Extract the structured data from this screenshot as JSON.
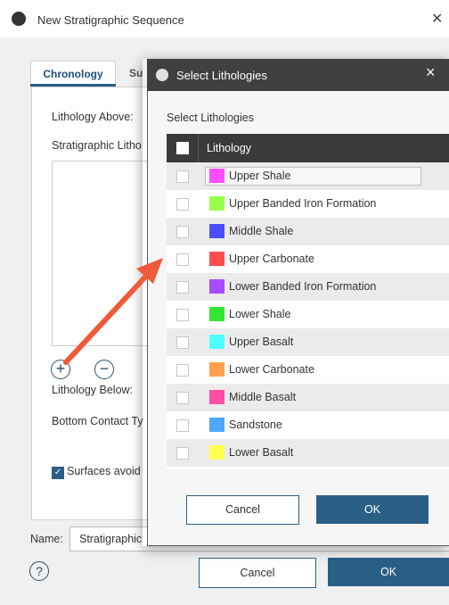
{
  "outer_dialog": {
    "title": "New Stratigraphic Sequence",
    "tabs": [
      {
        "label": "Chronology"
      },
      {
        "label": "Su"
      }
    ],
    "lithology_above_label": "Lithology Above:",
    "strat_lithologies_label": "Stratigraphic Litho",
    "lithology_below_label": "Lithology Below:",
    "bottom_contact_label": "Bottom Contact Ty",
    "surfaces_avoid_label": "Surfaces avoid",
    "surfaces_avoid_checked": true,
    "name_label": "Name:",
    "name_value": "Stratigraphic",
    "cancel_label": "Cancel",
    "ok_label": "OK",
    "help_glyph": "?",
    "add_glyph": "+",
    "remove_glyph": "−"
  },
  "modal": {
    "title": "Select Lithologies",
    "close_glyph": "×",
    "select_label": "Select Lithologies",
    "column_header": "Lithology",
    "rows": [
      {
        "name": "Upper Shale",
        "color": "#ff4dff"
      },
      {
        "name": "Upper Banded Iron Formation",
        "color": "#99ff4d"
      },
      {
        "name": "Middle Shale",
        "color": "#4d4dff"
      },
      {
        "name": "Upper Carbonate",
        "color": "#ff4d4d"
      },
      {
        "name": "Lower Banded Iron Formation",
        "color": "#a64dff"
      },
      {
        "name": "Lower Shale",
        "color": "#33e633"
      },
      {
        "name": "Upper Basalt",
        "color": "#4dffff"
      },
      {
        "name": "Lower Carbonate",
        "color": "#ffa04d"
      },
      {
        "name": "Middle Basalt",
        "color": "#ff4da6"
      },
      {
        "name": "Sandstone",
        "color": "#4da6ff"
      },
      {
        "name": "Lower Basalt",
        "color": "#ffff4d"
      }
    ],
    "cancel_label": "Cancel",
    "ok_label": "OK"
  },
  "colors": {
    "accent": "#2a5f86",
    "arrow": "#f0593a"
  }
}
